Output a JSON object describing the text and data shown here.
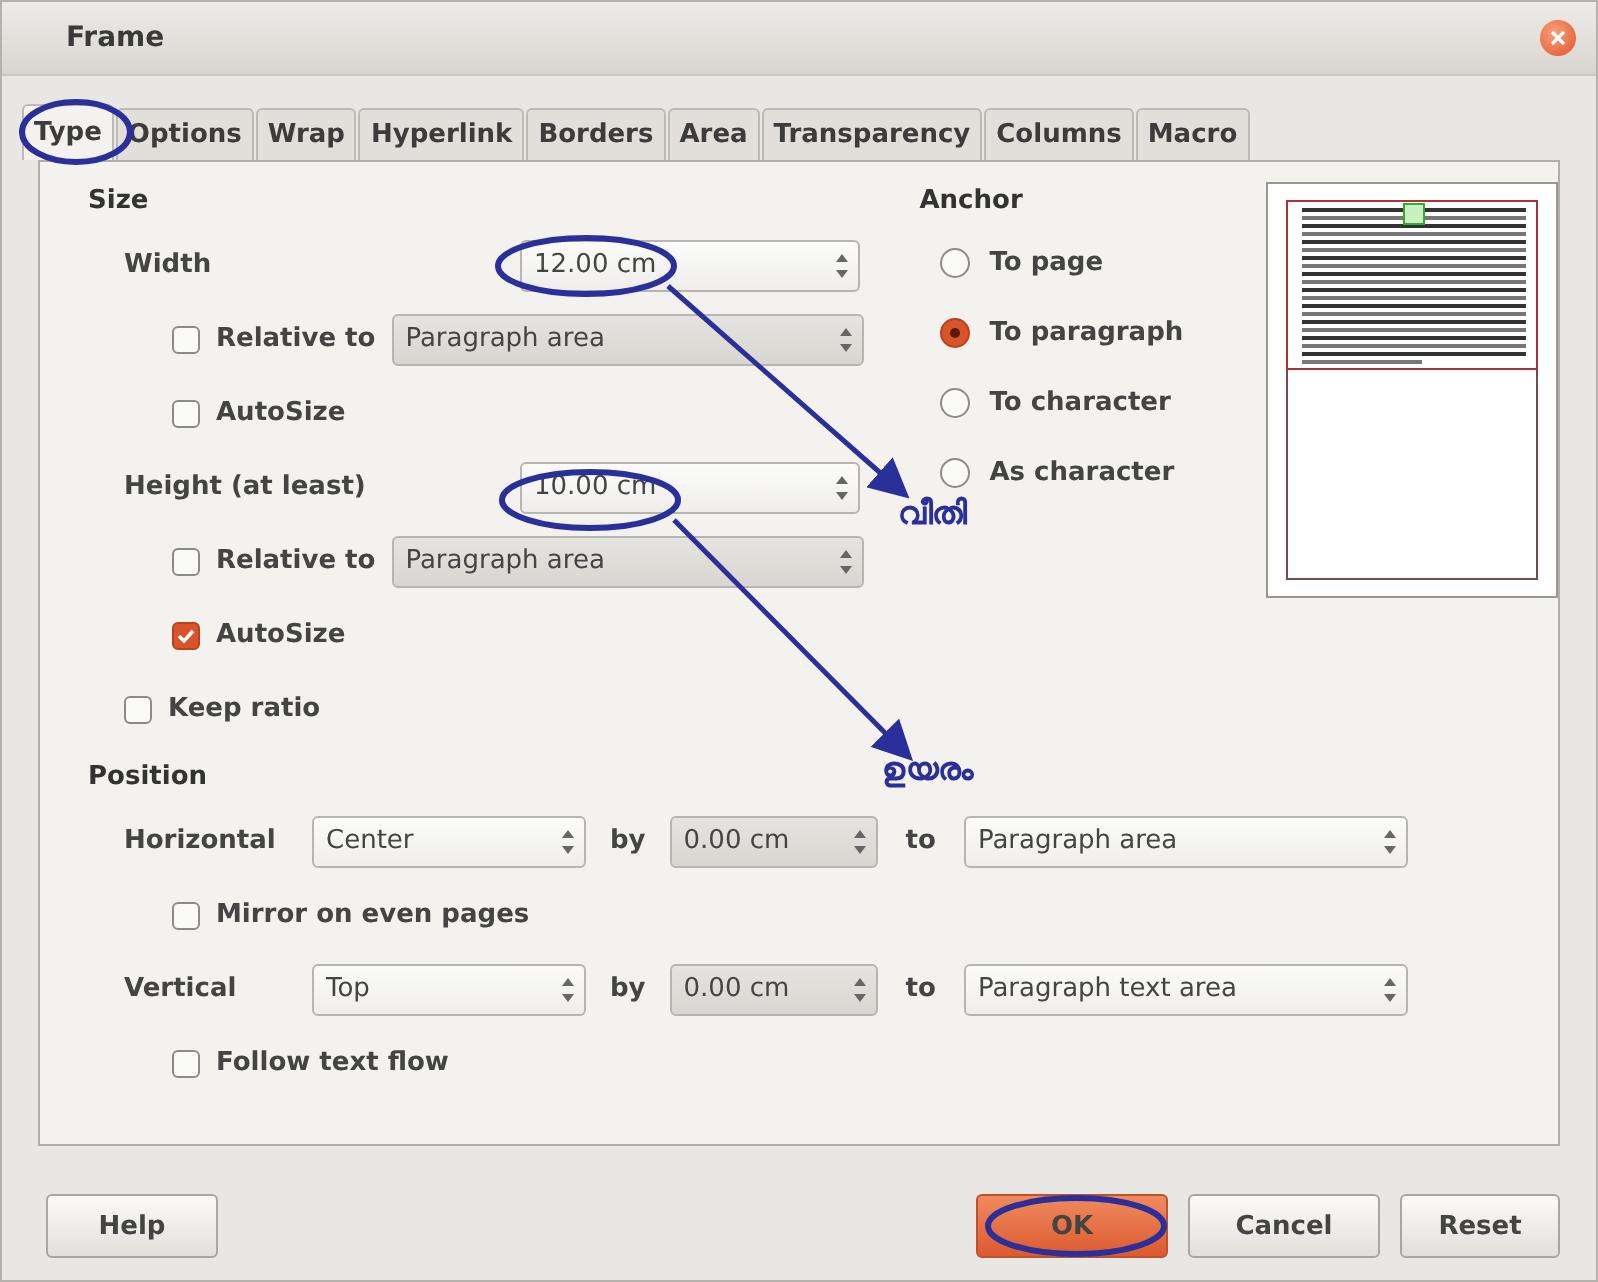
{
  "window": {
    "title": "Frame"
  },
  "tabs": [
    {
      "label": "Type",
      "selected": true
    },
    {
      "label": "Options",
      "selected": false
    },
    {
      "label": "Wrap",
      "selected": false
    },
    {
      "label": "Hyperlink",
      "selected": false
    },
    {
      "label": "Borders",
      "selected": false
    },
    {
      "label": "Area",
      "selected": false
    },
    {
      "label": "Transparency",
      "selected": false
    },
    {
      "label": "Columns",
      "selected": false
    },
    {
      "label": "Macro",
      "selected": false
    }
  ],
  "size": {
    "heading": "Size",
    "rows": [
      {
        "kind": "spin",
        "label": "Width",
        "value": "12.00 cm"
      },
      {
        "kind": "check_select",
        "label": "Relative to",
        "checked": false,
        "value": "Paragraph area"
      },
      {
        "kind": "check",
        "label": "AutoSize",
        "checked": false
      },
      {
        "kind": "spin",
        "label": "Height (at least)",
        "value": "10.00 cm"
      },
      {
        "kind": "check_select",
        "label": "Relative to",
        "checked": false,
        "value": "Paragraph area"
      },
      {
        "kind": "check",
        "label": "AutoSize",
        "checked": true
      },
      {
        "kind": "outer_check",
        "label": "Keep ratio",
        "checked": false
      }
    ]
  },
  "anchor": {
    "heading": "Anchor",
    "options": [
      {
        "label": "To page",
        "selected": false
      },
      {
        "label": "To paragraph",
        "selected": true
      },
      {
        "label": "To character",
        "selected": false
      },
      {
        "label": "As character",
        "selected": false
      }
    ]
  },
  "position": {
    "heading": "Position",
    "rows": [
      {
        "kind": "placement",
        "label": "Horizontal",
        "value": "Center",
        "by_label": "by",
        "by_value": "0.00 cm",
        "to_label": "to",
        "to_value": "Paragraph area"
      },
      {
        "kind": "check",
        "label": "Mirror on even pages",
        "checked": false
      },
      {
        "kind": "placement",
        "label": "Vertical",
        "value": "Top",
        "by_label": "by",
        "by_value": "0.00 cm",
        "to_label": "to",
        "to_value": "Paragraph text area"
      },
      {
        "kind": "check",
        "label": "Follow text flow",
        "checked": false
      }
    ]
  },
  "buttons": [
    {
      "label": "Help",
      "default": false
    },
    {
      "label": "OK",
      "default": true
    },
    {
      "label": "Cancel",
      "default": false
    },
    {
      "label": "Reset",
      "default": false
    }
  ],
  "annotations": {
    "labels": [
      "വീതി",
      "ഉയരം"
    ]
  }
}
